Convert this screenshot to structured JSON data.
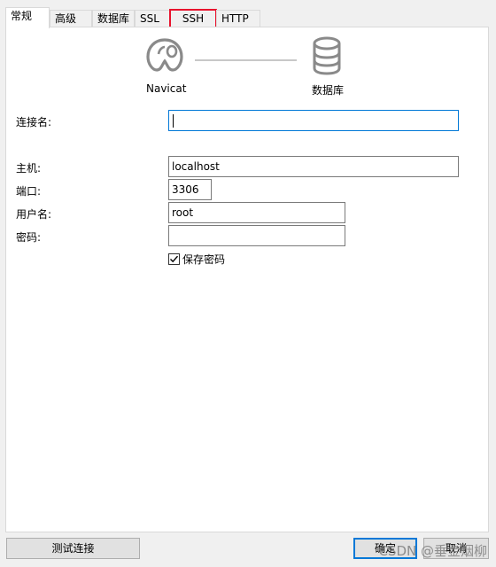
{
  "tabs": [
    {
      "label": "常规",
      "active": true
    },
    {
      "label": "高级"
    },
    {
      "label": "数据库"
    },
    {
      "label": "SSL"
    },
    {
      "label": "SSH",
      "highlighted": true
    },
    {
      "label": "HTTP"
    }
  ],
  "diagram": {
    "client_label": "Navicat",
    "client_icon": "navicat-icon",
    "server_label": "数据库",
    "server_icon": "database-icon"
  },
  "form": {
    "connection_name_label": "连接名:",
    "connection_name_value": "",
    "host_label": "主机:",
    "host_value": "localhost",
    "port_label": "端口:",
    "port_value": "3306",
    "user_label": "用户名:",
    "user_value": "root",
    "password_label": "密码:",
    "password_value": "",
    "save_password_label": "保存密码",
    "save_password_checked": true
  },
  "buttons": {
    "test_connection": "测试连接",
    "ok": "确定",
    "cancel": "取消"
  },
  "watermark": "CSDN @垂金烟柳",
  "colors": {
    "highlight_red": "#e8132d",
    "focus_blue": "#0078d7"
  }
}
